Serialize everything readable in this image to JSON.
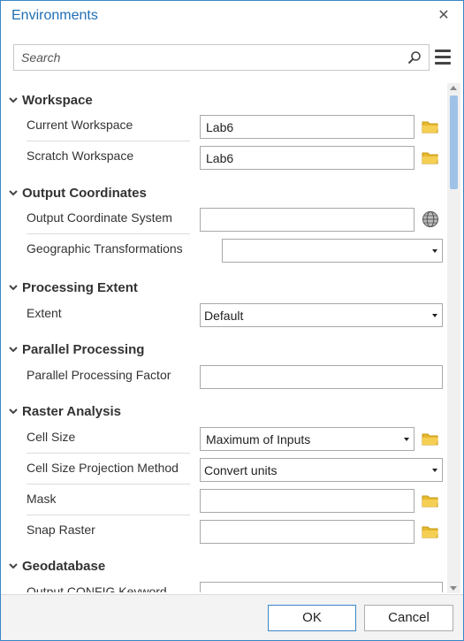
{
  "window": {
    "title": "Environments",
    "close_glyph": "✕"
  },
  "search": {
    "placeholder": "Search",
    "value": ""
  },
  "sections": {
    "workspace": {
      "title": "Workspace",
      "current_workspace": {
        "label": "Current Workspace",
        "value": "Lab6"
      },
      "scratch_workspace": {
        "label": "Scratch Workspace",
        "value": "Lab6"
      }
    },
    "output_coordinates": {
      "title": "Output Coordinates",
      "coord_system": {
        "label": "Output Coordinate System",
        "value": ""
      },
      "geo_transformations": {
        "label": "Geographic Transformations",
        "value": ""
      }
    },
    "processing_extent": {
      "title": "Processing Extent",
      "extent": {
        "label": "Extent",
        "value": "Default"
      }
    },
    "parallel_processing": {
      "title": "Parallel Processing",
      "factor": {
        "label": "Parallel Processing Factor",
        "value": ""
      }
    },
    "raster_analysis": {
      "title": "Raster Analysis",
      "cell_size": {
        "label": "Cell Size",
        "value": "Maximum of Inputs"
      },
      "cell_size_projection": {
        "label": "Cell Size Projection Method",
        "value": "Convert units"
      },
      "mask": {
        "label": "Mask",
        "value": ""
      },
      "snap_raster": {
        "label": "Snap Raster",
        "value": ""
      }
    },
    "geodatabase": {
      "title": "Geodatabase",
      "config_keyword": {
        "label": "Output CONFIG Keyword",
        "value": ""
      }
    }
  },
  "footer": {
    "ok_label": "OK",
    "cancel_label": "Cancel"
  },
  "colors": {
    "accent": "#1f6fb5",
    "folder": "#e5b82e",
    "scroll_thumb": "#9fc2e7"
  }
}
